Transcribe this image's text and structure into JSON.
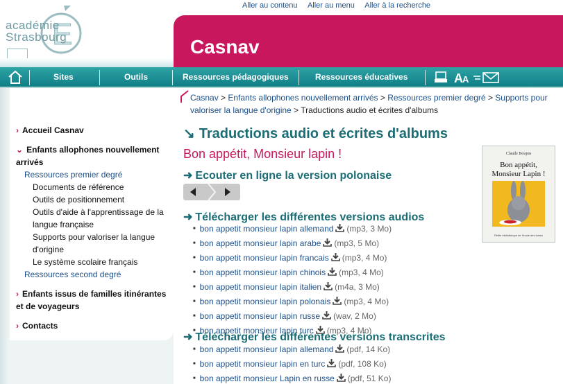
{
  "skip_links": [
    "Aller au contenu",
    "Aller au menu",
    "Aller à la recherche"
  ],
  "logo": {
    "line1": "académie",
    "line2": "Strasbourg"
  },
  "site_title": "Casnav",
  "nav": {
    "items": [
      "Sites",
      "Outils",
      "Ressources pédagogiques",
      "Ressources éducatives"
    ]
  },
  "breadcrumb": {
    "links": [
      "Casnav",
      "Enfants allophones nouvellement arrivés",
      "Ressources premier degré",
      "Supports pour valoriser la langue d'origine"
    ],
    "current": "Traductions audio et écrites d'albums"
  },
  "sidebar": {
    "items": [
      {
        "label": "Accueil Casnav"
      },
      {
        "label": "Enfants allophones nouvellement arrivés"
      },
      {
        "label": "Ressources premier degré"
      },
      {
        "label": "Documents de référence"
      },
      {
        "label": "Outils de positionnement"
      },
      {
        "label": "Outils d'aide à l'apprentissage de la langue française"
      },
      {
        "label": "Supports pour valoriser la langue d'origine"
      },
      {
        "label": "Le système scolaire français"
      },
      {
        "label": "Ressources second degré"
      },
      {
        "label": "Enfants issus de familles itinérantes et de voyageurs"
      },
      {
        "label": "Contacts"
      }
    ]
  },
  "main": {
    "page_title": "Traductions audio et écrites d'albums",
    "album_title": "Bon appétit, Monsieur lapin !",
    "cover": {
      "author": "Claude Boujon",
      "title": "Bon appétit, Monsieur Lapin !",
      "publisher": "Petite bibliothèque de l'école des loisirs"
    },
    "listen_heading": "Ecouter en ligne la version polonaise",
    "audio_heading": "Télécharger les différentes versions audios",
    "audio_files": [
      {
        "name": "bon appetit monsieur lapin allemand",
        "meta": "(mp3, 3 Mo)"
      },
      {
        "name": "bon appetit monsieur lapin arabe",
        "meta": "(mp3, 5 Mo)"
      },
      {
        "name": "bon appetit monsieur lapin francais",
        "meta": "(mp3, 4 Mo)"
      },
      {
        "name": "bon appetit monsieur lapin chinois",
        "meta": "(mp3, 4 Mo)"
      },
      {
        "name": "bon appetit monsieur lapin italien",
        "meta": "(m4a, 3 Mo)"
      },
      {
        "name": "bon appetit monsieur lapin polonais",
        "meta": "(mp3, 4 Mo)"
      },
      {
        "name": "bon appetit monsieur lapin russe",
        "meta": "(wav, 2 Mo)"
      },
      {
        "name": "bon appetit monsieur lapin turc",
        "meta": "(mp3, 4 Mo)"
      }
    ],
    "transcript_heading": "Télécharger les différentes versions transcrites",
    "transcript_files": [
      {
        "name": "bon appetit monsieur lapin allemand",
        "meta": "(pdf, 14 Ko)"
      },
      {
        "name": "bon appetit monsieur lapin en turc",
        "meta": "(pdf, 108 Ko)"
      },
      {
        "name": "bon appetit monsieur Lapin en russe",
        "meta": "(pdf, 51 Ko)"
      }
    ]
  },
  "colors": {
    "brand": "#c8175d",
    "teal": "#1a6d74",
    "link": "#1b4f8a"
  }
}
